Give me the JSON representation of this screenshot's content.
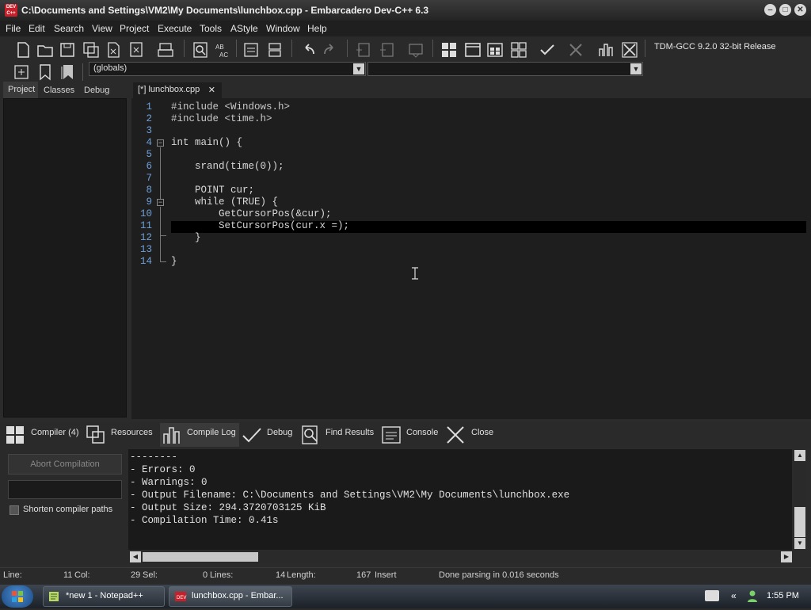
{
  "window": {
    "title": "C:\\Documents and Settings\\VM2\\My Documents\\lunchbox.cpp - Embarcadero Dev-C++ 6.3",
    "app_icon_text": "DEV C++",
    "buttons": {
      "minimize": "‒",
      "maximize": "□",
      "close": "✕"
    }
  },
  "menu": [
    "File",
    "Edit",
    "Search",
    "View",
    "Project",
    "Execute",
    "Tools",
    "AStyle",
    "Window",
    "Help"
  ],
  "toolbar": {
    "compiler": "TDM-GCC 9.2.0 32-bit Release",
    "scope_combo": "(globals)",
    "function_combo": ""
  },
  "left_tabs": [
    "Project",
    "Classes",
    "Debug"
  ],
  "editor": {
    "tab_label": "[*] lunchbox.cpp",
    "tab_close": "✕",
    "line_numbers": [
      "1",
      "2",
      "3",
      "4",
      "5",
      "6",
      "7",
      "8",
      "9",
      "10",
      "11",
      "12",
      "13",
      "14"
    ],
    "lines": [
      "#include <Windows.h>",
      "#include <time.h>",
      "",
      "int main() {",
      "",
      "    srand(time(0));",
      "",
      "    POINT cur;",
      "    while (TRUE) {",
      "        GetCursorPos(&cur);",
      "        SetCursorPos(cur.x =);",
      "    }",
      "",
      "}"
    ]
  },
  "bottom_tabs": [
    "Compiler (4)",
    "Resources",
    "Compile Log",
    "Debug",
    "Find Results",
    "Console",
    "Close"
  ],
  "compile_panel": {
    "abort_label": "Abort Compilation",
    "shorten_label": "Shorten compiler paths",
    "log": [
      "--------",
      "- Errors: 0",
      "- Warnings: 0",
      "- Output Filename: C:\\Documents and Settings\\VM2\\My Documents\\lunchbox.exe",
      "- Output Size: 294.3720703125 KiB",
      "- Compilation Time: 0.41s"
    ]
  },
  "status": {
    "line_label": "Line:",
    "line_value": "11",
    "col_label": "Col:",
    "col_value": "29",
    "sel_label": "Sel:",
    "sel_value": "0",
    "lines_label": "Lines:",
    "lines_value": "14",
    "length_label": "Length:",
    "length_value": "167",
    "mode": "Insert",
    "message": "Done parsing in 0.016 seconds"
  },
  "taskbar": {
    "items": [
      "*new 1 - Notepad++",
      "lunchbox.cpp - Embar..."
    ],
    "clock": "1:55 PM",
    "tray_chevron": "«"
  }
}
